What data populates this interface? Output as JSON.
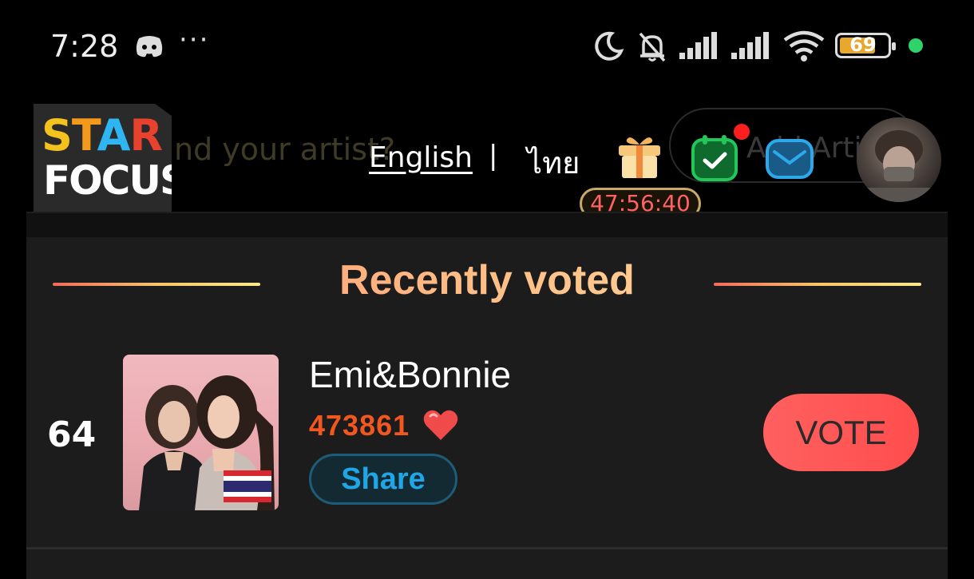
{
  "status_bar": {
    "time": "7:28",
    "more": "···",
    "battery": "69",
    "battery_color": "#e8a82e",
    "active_dot_color": "#2fd36a"
  },
  "header": {
    "logo_line1": [
      "S",
      "T",
      "A",
      "R"
    ],
    "logo_line2": "FOCUS",
    "search_placeholder": "nd your artist?",
    "lang_english": "English",
    "lang_separator": "|",
    "lang_thai": "ไทย",
    "add_artist": "Add Arti",
    "timer": "47:56:40"
  },
  "section": {
    "title": "Recently voted"
  },
  "entry": {
    "rank": "64",
    "name": "Emi&Bonnie",
    "votes": "473861",
    "share_label": "Share",
    "vote_label": "VOTE",
    "vote_color": "#ff5555",
    "accent_color": "#f2571f"
  },
  "icons": [
    "discord-icon",
    "moon-icon",
    "bell-off-icon",
    "signal-icon",
    "wifi-icon",
    "gift-icon",
    "calendar-check-icon",
    "mail-icon",
    "heart-icon",
    "thai-flag-icon"
  ]
}
